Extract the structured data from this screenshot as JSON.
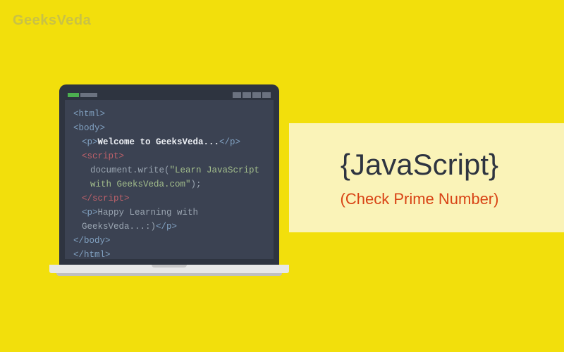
{
  "logo": "GeeksVeda",
  "code": {
    "l1": "<html>",
    "l2": "<body>",
    "l3a": "<p>",
    "l3b": "Welcome to GeeksVeda...",
    "l3c": "</p>",
    "l4": "<script>",
    "l5a": "document.write(",
    "l5b": "\"Learn JavaScript with GeeksVeda.com\"",
    "l5c": ");",
    "l6": "</script>",
    "l7a": "<p>",
    "l7b": "Happy Learning with GeeksVeda...:)",
    "l7c": "</p>",
    "l8": "</body>",
    "l9": "</html>"
  },
  "title": {
    "main": "{JavaScript}",
    "sub": "(Check Prime Number)"
  }
}
